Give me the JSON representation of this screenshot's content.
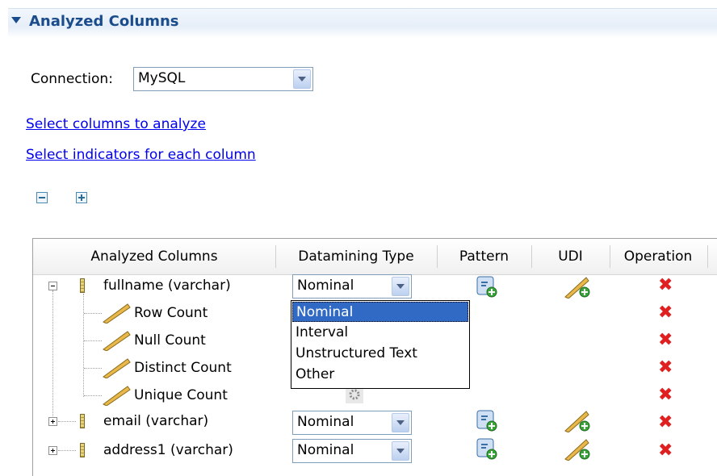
{
  "section": {
    "title": "Analyzed Columns"
  },
  "connection": {
    "label": "Connection:",
    "value": "MySQL"
  },
  "links": {
    "select_columns": "Select columns to analyze",
    "select_indicators": "Select indicators for each column"
  },
  "table": {
    "headers": [
      "Analyzed Columns",
      "Datamining Type",
      "Pattern",
      "UDI",
      "Operation"
    ],
    "rows": [
      {
        "label": "fullname (varchar)",
        "type": "Nominal"
      },
      {
        "label": "Row Count"
      },
      {
        "label": "Null Count"
      },
      {
        "label": "Distinct Count"
      },
      {
        "label": "Unique Count"
      },
      {
        "label": "email (varchar)",
        "type": "Nominal"
      },
      {
        "label": "address1 (varchar)",
        "type": "Nominal"
      }
    ]
  },
  "dropdown": {
    "options": [
      "Nominal",
      "Interval",
      "Unstructured Text",
      "Other"
    ],
    "selected": "Nominal"
  },
  "icons": {
    "delete": "delete-x-icon",
    "pattern": "pattern-add-icon",
    "udi": "indicator-ruler-icon",
    "column": "column-icon"
  },
  "colors": {
    "accent": "#1a4c8c",
    "link": "#0000ee",
    "selection": "#316ac5",
    "delete": "#e02020"
  }
}
